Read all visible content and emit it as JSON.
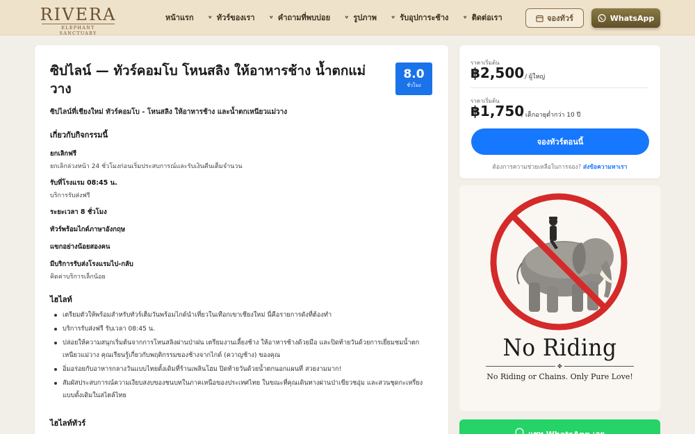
{
  "brand": {
    "name": "RIVERA",
    "tagline": "ELEPHANT SANCTUARY"
  },
  "nav": {
    "items": [
      {
        "label": "หน้าแรก",
        "has_dropdown": false
      },
      {
        "label": "ทัวร์ของเรา",
        "has_dropdown": true
      },
      {
        "label": "คำถามที่พบบ่อย",
        "has_dropdown": true
      },
      {
        "label": "รูปภาพ",
        "has_dropdown": true
      },
      {
        "label": "รับอุปการะช้าง",
        "has_dropdown": true
      },
      {
        "label": "ติดต่อเรา",
        "has_dropdown": true
      }
    ],
    "book_label": "จองทัวร์",
    "whatsapp_label": "WhatsApp"
  },
  "tour": {
    "title": "ซิปไลน์ — ทัวร์คอมโบ โหนสลิง ให้อาหารช้าง น้ำตกแม่วาง",
    "duration_value": "8.0",
    "duration_unit": "ชั่วโมง",
    "subtitle": "ซิปไลน์ที่เชียงใหม่ ทัวร์คอมโบ - โหนสลิง ให้อาหารช้าง และน้ำตกเหนียวแม่วาง"
  },
  "about": {
    "heading": "เกี่ยวกับกิจกรรมนี้",
    "items": [
      {
        "title": "ยกเลิกฟรี",
        "desc": "ยกเลิกล่วงหน้า 24 ชั่วโมงก่อนเริ่มประสบการณ์และรับเงินคืนเต็มจำนวน"
      },
      {
        "title": "รับที่โรงแรม 08:45 น.",
        "desc": "บริการรับส่งฟรี"
      },
      {
        "title": "ระยะเวลา 8 ชั่วโมง",
        "desc": ""
      },
      {
        "title": "ทัวร์พร้อมไกด์ภาษาอังกฤษ",
        "desc": ""
      },
      {
        "title": "แขกอย่างน้อยสองคน",
        "desc": ""
      },
      {
        "title": "มีบริการรับส่งโรงแรมไป-กลับ",
        "desc": "คิดค่าบริการเล็กน้อย"
      }
    ]
  },
  "highlights": {
    "heading": "ไฮไลท์",
    "items": [
      "เตรียมตัวให้พร้อมสำหรับทัวร์เต็มวันพร้อมไกด์นำเที่ยวในเทือกเขาเชียงใหม่ นี่คือรายการดังที่ต้องทำ",
      "บริการรับส่งฟรี รับเวลา 08:45 น.",
      "ปล่อยให้ความสนุกเริ่มต้นจากการโหนสลิงผ่านป่าฝน เตรียมงานเลี้ยงช้าง ให้อาหารช้างด้วยมือ และปิดท้ายวันด้วยการเยี่ยมชมน้ำตกเหนียวแม่วาง คุณเรียนรู้เกี่ยวกับพฤติกรรมของช้างจากไกด์ (ควาญช้าง) ของคุณ",
      "อิ่มอร่อยกับอาหารกลางวันแบบไทยดั้งเดิมที่ร้านเพลินโฮม ปิดท้ายวันด้วยน้ำตกนอกแผนที่ สวยงามมาก!",
      "สัมผัสประสบการณ์ความเงียบสงบของชนบทในภาคเหนือของประเทศไทย ในขณะที่คุณเดินทางผ่านป่าเขียวชอุ่ม และสวนชุดกะเหรี่ยงแบบดั้งเดิมในสไตล์ไทย"
    ]
  },
  "tour_highlights_heading": "ไฮไลท์ทัวร์",
  "pricing": {
    "adult": {
      "label": "ราคาเริ่มต้น",
      "amount": "฿2,500",
      "unit": "/ ผู้ใหญ่"
    },
    "child": {
      "label": "ราคาเริ่มต้น",
      "amount": "฿1,750",
      "unit": "/ เด็กอายุต่ำกว่า 10 ปี"
    },
    "book_button": "จองทัวร์ตอนนี้",
    "help_text": "ต้องการความช่วยเหลือในการจอง?",
    "help_link": "ส่งข้อความหาเรา"
  },
  "promo_image": {
    "headline": "No Riding",
    "tagline": "No Riding or Chains. Only Pure Love!"
  },
  "whatsapp_bottom": {
    "label": "แชท WhatsApp เลย"
  },
  "colors": {
    "header_bg": "#efe2cb",
    "brand_brown": "#6b5130",
    "primary_blue": "#1677ff",
    "whatsapp_green": "#25d366",
    "prohibition_red": "#d42a2a"
  }
}
